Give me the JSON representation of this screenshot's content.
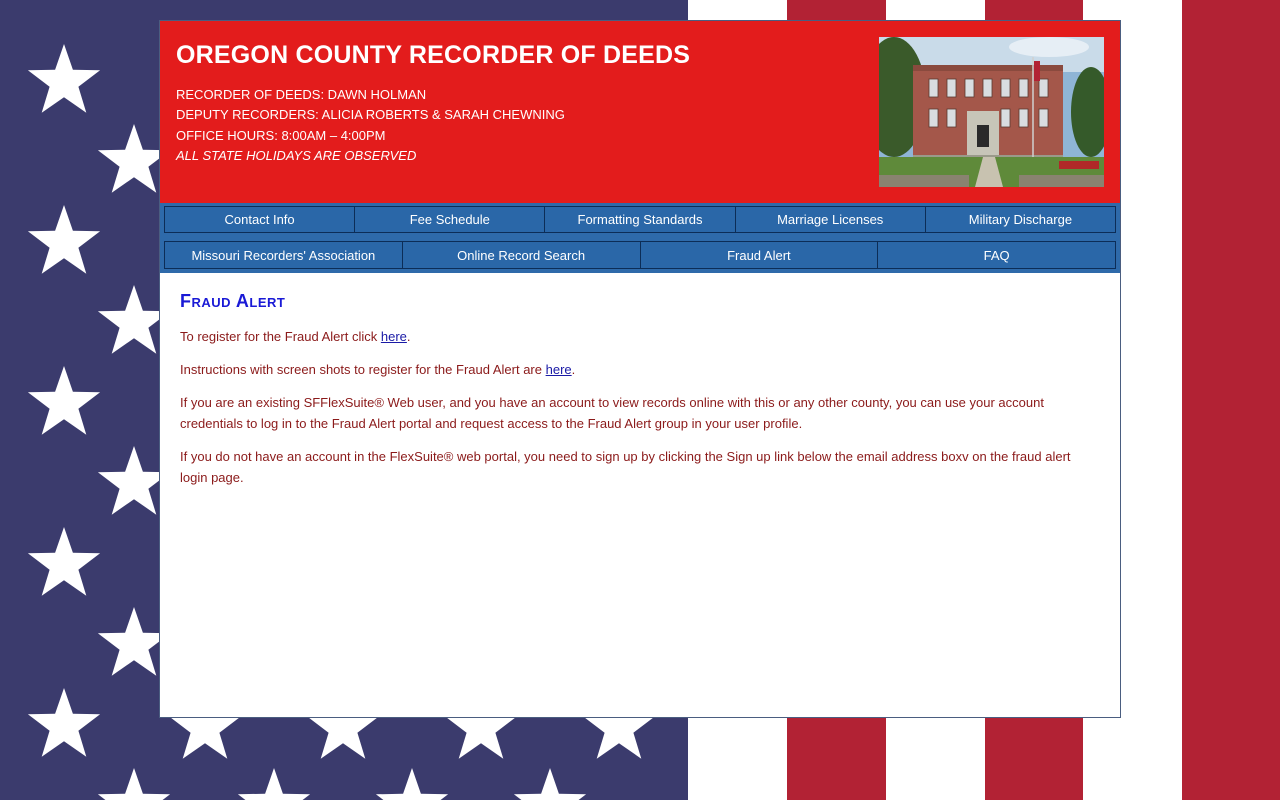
{
  "header": {
    "title": "OREGON COUNTY RECORDER OF DEEDS",
    "recorder": "RECORDER OF DEEDS: DAWN HOLMAN",
    "deputies": "DEPUTY RECORDERS: ALICIA ROBERTS & SARAH CHEWNING",
    "hours": "OFFICE HOURS: 8:00AM – 4:00PM",
    "holidays": "ALL STATE HOLIDAYS ARE OBSERVED"
  },
  "nav": {
    "row1": [
      "Contact Info",
      "Fee Schedule",
      "Formatting Standards",
      "Marriage Licenses",
      "Military Discharge"
    ],
    "row2": [
      "Missouri Recorders' Association",
      "Online Record Search",
      "Fraud Alert",
      "FAQ"
    ]
  },
  "content": {
    "heading": "Fraud Alert",
    "p1_before": "To register for the Fraud Alert click ",
    "p1_link": "here",
    "p1_after": ".",
    "p2_before": "Instructions with screen shots to register for the Fraud Alert are ",
    "p2_link": "here",
    "p2_after": ".",
    "p3": "If you are an existing SFFlexSuite® Web user, and you have an account to view records online with this or any other county, you can use your account credentials to log in to the Fraud Alert portal and request access to the Fraud Alert group in your user profile.",
    "p4": "If you do not have an account in the FlexSuite® web portal, you need to sign up by clicking the Sign up link below the email address boxv on the fraud alert login page."
  },
  "colors": {
    "header_red": "#e31c1c",
    "nav_blue": "#2e6aaa",
    "heading_blue": "#1a1ad6",
    "text_red": "#8b1a1a",
    "flag_navy": "#3b3b6d",
    "flag_red": "#b22234"
  }
}
